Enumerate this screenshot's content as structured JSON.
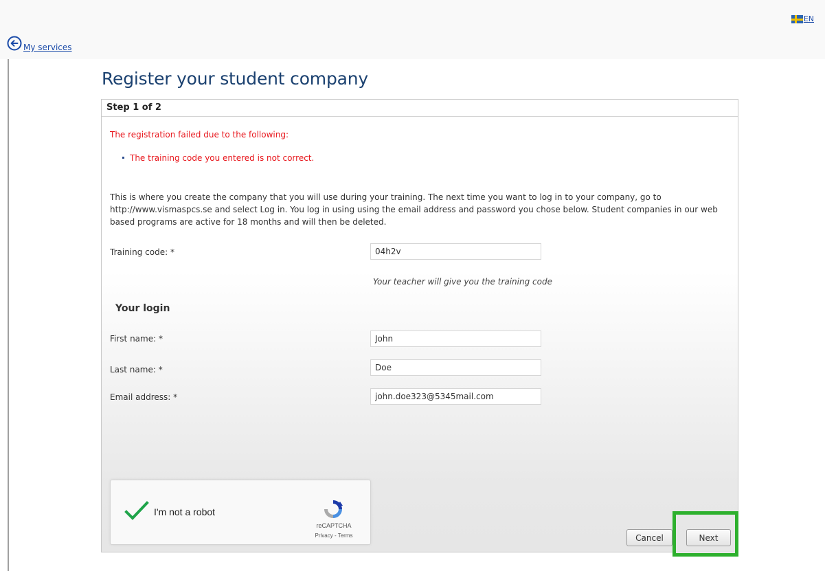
{
  "header": {
    "language": "EN",
    "flag_icon": "sweden-flag-icon",
    "back_icon": "circle-arrow-left-icon",
    "back_link": "My services"
  },
  "page": {
    "title": "Register your student company"
  },
  "panel": {
    "step": "Step 1 of 2",
    "error_title": "The registration failed due to the following:",
    "error_items": [
      "The training code you entered is not correct."
    ],
    "intro": "This is where you create the company that you will use during your training. The next time you want to log in to your company, go to http://www.vismaspcs.se and select Log in. You log in using using the email address and password you chose below. Student companies in our web based programs are active for 18 months and will then be deleted.",
    "training_code": {
      "label": "Training code: *",
      "value": "04h2v",
      "hint": "Your teacher will give you the training code"
    },
    "login_heading": "Your login",
    "first_name": {
      "label": "First name: *",
      "value": "John"
    },
    "last_name": {
      "label": "Last name: *",
      "value": "Doe"
    },
    "email": {
      "label": "Email address: *",
      "value": "john.doe323@5345mail.com"
    },
    "captcha": {
      "label": "I'm not a robot",
      "brand": "reCAPTCHA",
      "links": "Privacy - Terms",
      "checked": true
    },
    "buttons": {
      "cancel": "Cancel",
      "next": "Next"
    }
  },
  "colors": {
    "title": "#1b4170",
    "error": "#e8161c",
    "link": "#1a4aa8",
    "highlight": "#2db02d",
    "check": "#1fa44a"
  }
}
